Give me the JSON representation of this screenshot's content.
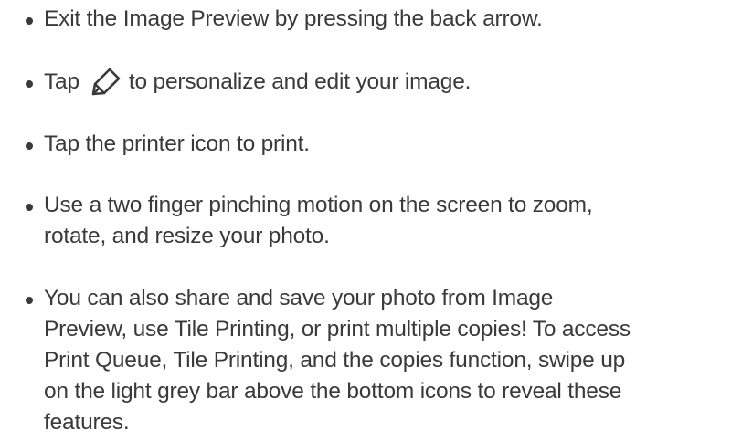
{
  "bullets": [
    {
      "line1": "Exit the Image Preview by pressing the back arrow."
    },
    {
      "before_icon": "Tap",
      "icon": "pen-icon",
      "after_icon": "to personalize and edit your image."
    },
    {
      "line1": "Tap the printer icon to print."
    },
    {
      "line1": "Use a two finger pinching motion on the screen to zoom,",
      "line2": "rotate, and resize your photo."
    },
    {
      "line1": "You can also share and save your photo from Image",
      "line2": "Preview, use Tile Printing, or print multiple copies! To access",
      "line3": "Print Queue, Tile Printing, and the copies function, swipe up",
      "line4": "on the light grey bar above the bottom icons to reveal these",
      "line5": "features."
    }
  ]
}
